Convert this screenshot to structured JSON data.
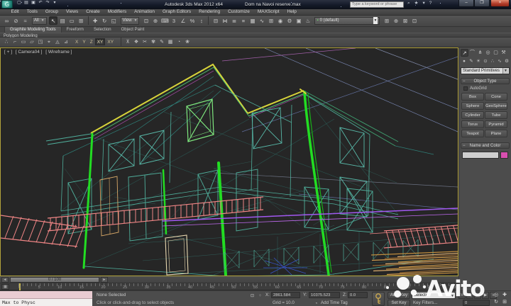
{
  "colors": {
    "selected_green": "#22dd22",
    "roof_yellow": "#d8d43a",
    "wire_teal": "#4fae9b",
    "railing_salmon": "#ef8585",
    "purple_spline": "#a258f2",
    "decking_orange": "#c8913f",
    "viewport_border_active": "#b2a33c",
    "close_button_red": "#b03a28",
    "object_color_swatch": "#d94fb0"
  },
  "title_bar": {
    "app_title": "Autodesk 3ds Max 2012 x64",
    "document_name": "Dom na Navoi reserve.max",
    "logo_glyph": "Ǵ",
    "qat_icons": [
      {
        "name": "new-scene-icon",
        "glyph": "▢"
      },
      {
        "name": "open-file-icon",
        "glyph": "▤"
      },
      {
        "name": "save-file-icon",
        "glyph": "▣"
      },
      {
        "name": "undo-icon",
        "glyph": "↶"
      },
      {
        "name": "redo-icon",
        "glyph": "↷"
      },
      {
        "name": "project-folder-icon",
        "glyph": "▾"
      }
    ],
    "search_placeholder": "Type a keyword or phrase",
    "infocenter_icons": [
      {
        "name": "search-icon",
        "glyph": "⌕"
      },
      {
        "name": "communication-center-icon",
        "glyph": "★"
      },
      {
        "name": "favorites-icon",
        "glyph": "▾"
      },
      {
        "name": "help-icon",
        "glyph": "?"
      }
    ],
    "window_buttons": [
      {
        "name": "minimize-button",
        "glyph": "–"
      },
      {
        "name": "maximize-button",
        "glyph": "❐"
      },
      {
        "name": "close-button",
        "glyph": "×"
      }
    ]
  },
  "menu_bar": [
    "Edit",
    "Tools",
    "Group",
    "Views",
    "Create",
    "Modifiers",
    "Animation",
    "Graph Editors",
    "Rendering",
    "Customize",
    "MAXScript",
    "Help"
  ],
  "main_toolbar": {
    "selection_filter_value": "All",
    "coord_system_value": "View",
    "layer_combo_value": "0 (default)",
    "icons_link": [
      {
        "name": "select-and-link-icon",
        "glyph": "∞"
      },
      {
        "name": "unlink-selection-icon",
        "glyph": "⊘"
      },
      {
        "name": "bind-space-warp-icon",
        "glyph": "≈"
      }
    ],
    "icons_select": [
      {
        "name": "select-object-icon",
        "glyph": "↖",
        "pressed": true
      },
      {
        "name": "select-by-name-icon",
        "glyph": "▤"
      },
      {
        "name": "rectangular-selection-icon",
        "glyph": "▭"
      },
      {
        "name": "window-crossing-icon",
        "glyph": "⊞"
      }
    ],
    "icons_transform": [
      {
        "name": "select-move-icon",
        "glyph": "✚"
      },
      {
        "name": "select-rotate-icon",
        "glyph": "↻"
      },
      {
        "name": "select-scale-icon",
        "glyph": "◱"
      }
    ],
    "icons_snap": [
      {
        "name": "use-pivot-center-icon",
        "glyph": "⊡"
      },
      {
        "name": "select-manipulate-icon",
        "glyph": "⊕"
      },
      {
        "name": "keyboard-override-icon",
        "glyph": "⌨"
      },
      {
        "name": "snap-toggle-3d-icon",
        "glyph": "3"
      },
      {
        "name": "angle-snap-icon",
        "glyph": "∠"
      },
      {
        "name": "percent-snap-icon",
        "glyph": "%"
      },
      {
        "name": "spinner-snap-icon",
        "glyph": "↕"
      }
    ],
    "icons_tools": [
      {
        "name": "named-selection-sets-icon",
        "glyph": "⊟"
      },
      {
        "name": "mirror-icon",
        "glyph": "⋈"
      },
      {
        "name": "align-icon",
        "glyph": "≣"
      },
      {
        "name": "layer-manager-icon",
        "glyph": "≡"
      },
      {
        "name": "ribbon-toggle-icon",
        "glyph": "▦"
      },
      {
        "name": "curve-editor-icon",
        "glyph": "∿"
      },
      {
        "name": "schematic-view-icon",
        "glyph": "⊞"
      },
      {
        "name": "material-editor-icon",
        "glyph": "◉"
      },
      {
        "name": "render-setup-icon",
        "glyph": "⚙"
      },
      {
        "name": "rendered-frame-icon",
        "glyph": "▣"
      },
      {
        "name": "render-production-icon",
        "glyph": "♨"
      }
    ],
    "icons_layer_right": [
      {
        "name": "create-layer-icon",
        "glyph": "⊞"
      },
      {
        "name": "add-selection-to-layer-icon",
        "glyph": "⊕"
      },
      {
        "name": "select-objects-in-layer-icon",
        "glyph": "⊠"
      },
      {
        "name": "set-current-layer-icon",
        "glyph": "⊡"
      }
    ]
  },
  "ribbon": {
    "tabs": [
      {
        "label": "Graphite Modeling Tools",
        "pressed": true
      },
      {
        "label": "Freeform"
      },
      {
        "label": "Selection"
      },
      {
        "label": "Object Paint"
      }
    ],
    "panel_title": "Polygon Modeling",
    "icons_a": [
      {
        "name": "vertex-mode-icon",
        "glyph": "∴"
      },
      {
        "name": "edge-mode-icon",
        "glyph": "⌐"
      },
      {
        "name": "border-mode-icon",
        "glyph": "▭"
      },
      {
        "name": "polygon-mode-icon",
        "glyph": "▱"
      },
      {
        "name": "element-mode-icon",
        "glyph": "◳"
      },
      {
        "name": "pivot-icon",
        "glyph": "⌖"
      },
      {
        "name": "preview-icon",
        "glyph": "◬"
      },
      {
        "name": "modifier-icon",
        "glyph": "⊿"
      }
    ],
    "axis_buttons": [
      {
        "label": "X"
      },
      {
        "label": "Y"
      },
      {
        "label": "Z"
      },
      {
        "label": "XY",
        "pressed": true
      },
      {
        "label": "XY"
      }
    ],
    "icons_b": [
      {
        "name": "collapse-icon",
        "glyph": "⊼"
      },
      {
        "name": "attach-icon",
        "glyph": "❖"
      },
      {
        "name": "slice-icon",
        "glyph": "✂"
      },
      {
        "name": "swift-loop-icon",
        "glyph": "✾"
      },
      {
        "name": "paint-connect-icon",
        "glyph": "✎"
      },
      {
        "name": "quadrify-icon",
        "glyph": "▦"
      },
      {
        "name": "nurms-icon",
        "glyph": "◔"
      },
      {
        "name": "generate-topology-icon",
        "glyph": "❀"
      }
    ]
  },
  "viewport": {
    "label_general": "[ + ]",
    "label_pov": "[ Camera04 ]",
    "label_shading": "[ Wireframe ]"
  },
  "command_panel": {
    "tabs": [
      {
        "name": "create-tab-icon",
        "glyph": "↗",
        "pressed": true
      },
      {
        "name": "modify-tab-icon",
        "glyph": "⌒"
      },
      {
        "name": "hierarchy-tab-icon",
        "glyph": "⋔"
      },
      {
        "name": "motion-tab-icon",
        "glyph": "◎"
      },
      {
        "name": "display-tab-icon",
        "glyph": "▢"
      },
      {
        "name": "utilities-tab-icon",
        "glyph": "⚒"
      }
    ],
    "categories": [
      {
        "name": "geometry-icon",
        "glyph": "●"
      },
      {
        "name": "shapes-icon",
        "glyph": "✎"
      },
      {
        "name": "lights-icon",
        "glyph": "☀"
      },
      {
        "name": "cameras-icon",
        "glyph": "⊙"
      },
      {
        "name": "helpers-icon",
        "glyph": "∴"
      },
      {
        "name": "space-warps-icon",
        "glyph": "∿"
      },
      {
        "name": "systems-icon",
        "glyph": "⚙"
      }
    ],
    "object_class_value": "Standard Primitives",
    "object_type_title": "Object Type",
    "autogrid_label": "AutoGrid",
    "primitive_buttons": [
      "Box",
      "Cone",
      "Sphere",
      "GeoSphere",
      "Cylinder",
      "Tube",
      "Torus",
      "Pyramid",
      "Teapot",
      "Plane"
    ],
    "name_color_title": "Name and Color"
  },
  "timeline": {
    "slider_value": "0 / 100",
    "tick_labels": [
      "0",
      "5",
      "10",
      "15",
      "20",
      "25",
      "30",
      "35",
      "40",
      "45",
      "50",
      "55",
      "60",
      "65",
      "70",
      "75",
      "80",
      "85",
      "90",
      "95",
      "100"
    ]
  },
  "status_bar": {
    "maxscript_mini": "Max to Physc",
    "selection_status": "None Selected",
    "prompt_line": "Click or click-and-drag to select objects",
    "coord_x_label": "X:",
    "coord_x": "2861.584",
    "coord_y_label": "Y:",
    "coord_y": "10375.523",
    "coord_z_label": "Z:",
    "coord_z": "0.0",
    "grid_info": "Grid = 10.0",
    "time_tag": "Add Time Tag",
    "auto_key": "Auto Key",
    "set_key": "Set Key",
    "selection_set_value": "Selected",
    "key_filters": "Key Filters...",
    "frame_field": "0",
    "playback_icons": [
      {
        "name": "go-to-start-icon",
        "glyph": "«"
      },
      {
        "name": "prev-frame-icon",
        "glyph": "◀"
      },
      {
        "name": "play-icon",
        "glyph": "▶"
      },
      {
        "name": "next-frame-icon",
        "glyph": "▶"
      },
      {
        "name": "go-to-end-icon",
        "glyph": "»"
      }
    ],
    "nav_icons": [
      {
        "name": "zoom-icon",
        "glyph": "◎"
      },
      {
        "name": "pan-hand-icon",
        "glyph": "✚"
      },
      {
        "name": "orbit-icon",
        "glyph": "↻"
      },
      {
        "name": "maximize-viewport-icon",
        "glyph": "⊞"
      }
    ]
  },
  "watermark": {
    "text": "Avito"
  }
}
